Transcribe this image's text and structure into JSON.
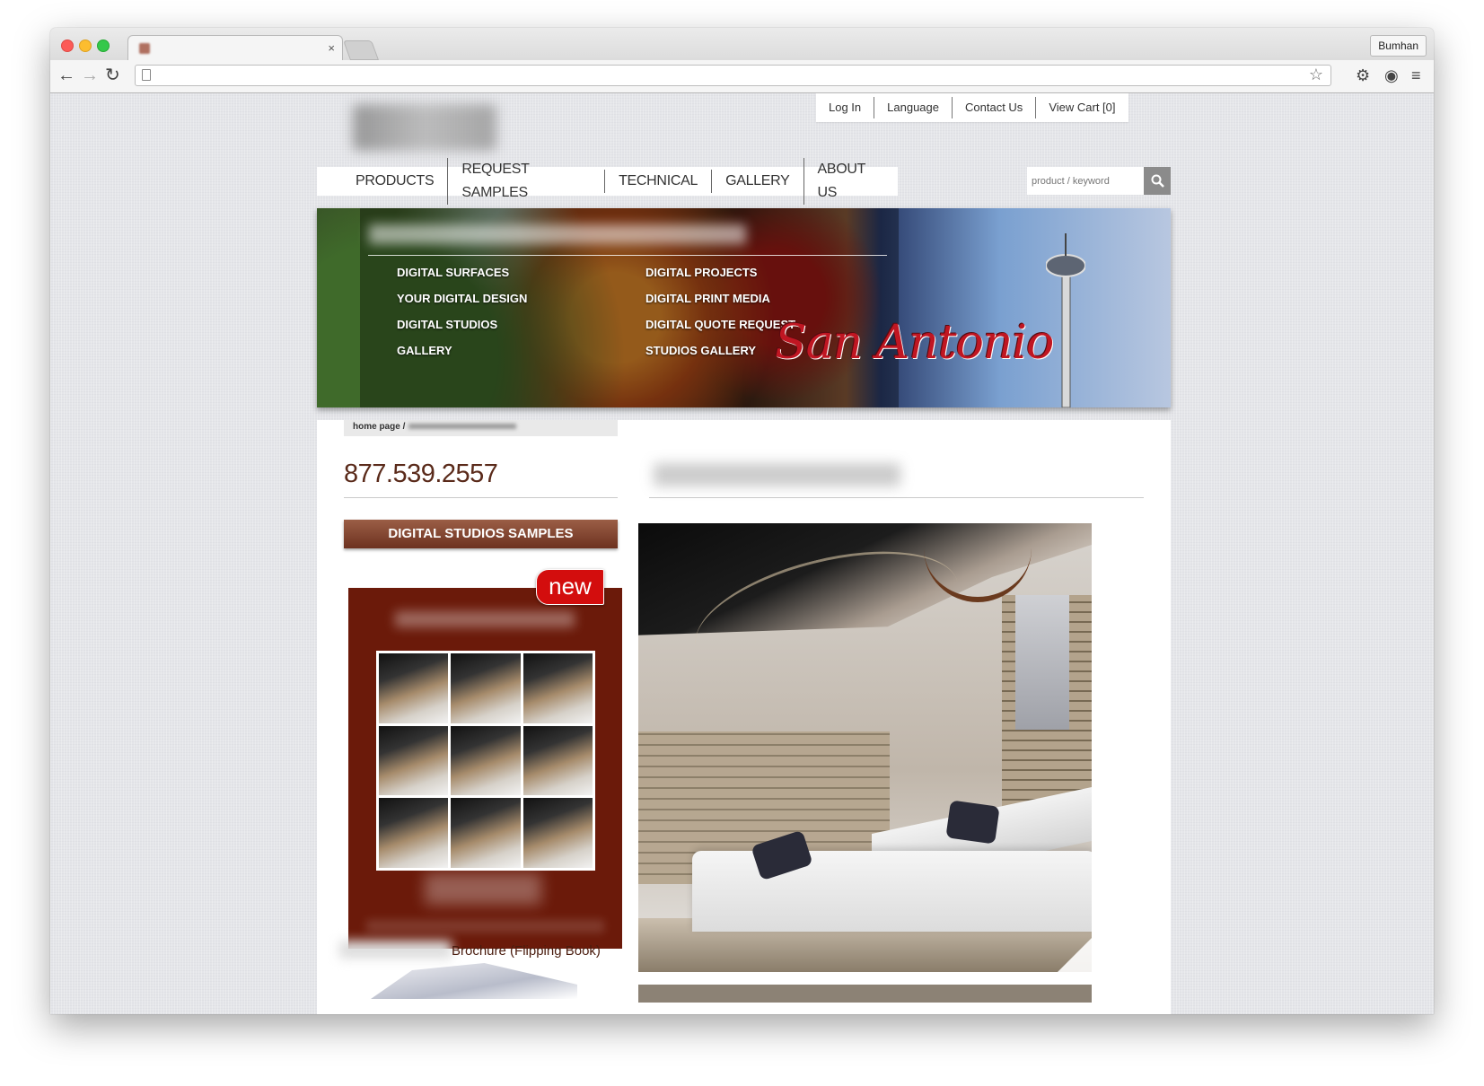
{
  "browser": {
    "tab_title": "",
    "tab_close": "×",
    "profile_name": "Bumhan",
    "url": "",
    "back_glyph": "←",
    "forward_glyph": "→",
    "reload_glyph": "↻",
    "star_glyph": "☆",
    "settings_glyph": "⚙",
    "pocket_glyph": "◉",
    "menu_glyph": "≡"
  },
  "site": {
    "util_nav": [
      "Log In",
      "Language",
      "Contact Us",
      "View Cart [0]"
    ],
    "main_nav": [
      "PRODUCTS",
      "REQUEST SAMPLES",
      "TECHNICAL",
      "GALLERY",
      "ABOUT US"
    ],
    "search_placeholder": "product / keyword",
    "banner": {
      "left_links": [
        "DIGITAL SURFACES",
        "YOUR DIGITAL DESIGN",
        "DIGITAL STUDIOS",
        "GALLERY"
      ],
      "right_links": [
        "DIGITAL PROJECTS",
        "DIGITAL PRINT MEDIA",
        "DIGITAL QUOTE REQUEST",
        "STUDIOS GALLERY"
      ],
      "city_script": "San Antonio"
    },
    "breadcrumb_home": "home page /",
    "phone": "877.539.2557",
    "studio_samples_button": "DIGITAL STUDIOS SAMPLES",
    "new_badge": "new",
    "brochure_label": "Brochure (Flipping Book)"
  },
  "colors": {
    "accent_brown": "#6d3220",
    "promo_red": "#6b1a0a",
    "badge_red": "#d30d0d"
  }
}
